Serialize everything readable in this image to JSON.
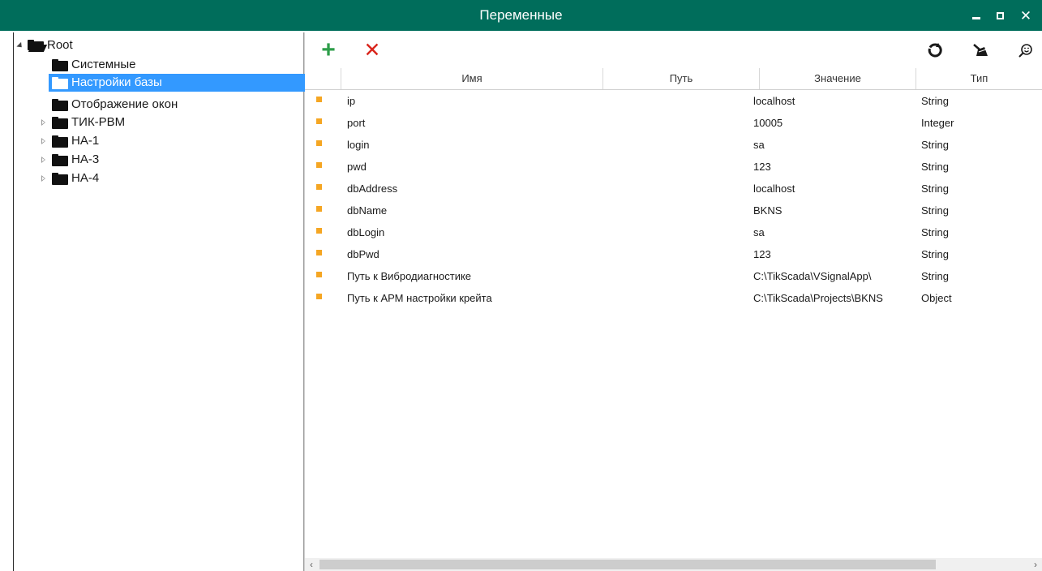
{
  "window": {
    "title": "Переменные",
    "controls": {
      "minimize_icon": "minimize-icon",
      "maximize_icon": "maximize-icon",
      "close_glyph": "✕"
    }
  },
  "tree": {
    "root": {
      "label": "Root"
    },
    "children": [
      {
        "label": "Системные",
        "expandable": false,
        "selected": false
      },
      {
        "label": "Настройки базы",
        "expandable": false,
        "selected": true
      },
      {
        "label": "Отображение окон",
        "expandable": false,
        "selected": false
      },
      {
        "label": "ТИК-РВМ",
        "expandable": true,
        "selected": false
      },
      {
        "label": "НА-1",
        "expandable": true,
        "selected": false
      },
      {
        "label": "НА-3",
        "expandable": true,
        "selected": false
      },
      {
        "label": "НА-4",
        "expandable": true,
        "selected": false
      }
    ]
  },
  "toolbar": {
    "add_glyph": "+",
    "delete_glyph": "✕",
    "refresh_icon": "refresh-icon",
    "clean_icon": "broom-icon",
    "search_icon": "search-icon"
  },
  "grid": {
    "columns": [
      "Имя",
      "Путь",
      "Значение",
      "Тип"
    ],
    "rows": [
      {
        "name": "ip",
        "path": "",
        "value": "localhost",
        "type": "String"
      },
      {
        "name": "port",
        "path": "",
        "value": "10005",
        "type": "Integer"
      },
      {
        "name": "login",
        "path": "",
        "value": "sa",
        "type": "String"
      },
      {
        "name": "pwd",
        "path": "",
        "value": "123",
        "type": "String"
      },
      {
        "name": "dbAddress",
        "path": "",
        "value": "localhost",
        "type": "String"
      },
      {
        "name": "dbName",
        "path": "",
        "value": "BKNS",
        "type": "String"
      },
      {
        "name": "dbLogin",
        "path": "",
        "value": "sa",
        "type": "String"
      },
      {
        "name": "dbPwd",
        "path": "",
        "value": "123",
        "type": "String"
      },
      {
        "name": "Путь к Вибродиагностике",
        "path": "",
        "value": "C:\\TikScada\\VSignalApp\\",
        "type": "String"
      },
      {
        "name": "Путь к АРМ настройки крейта",
        "path": "",
        "value": "C:\\TikScada\\Projects\\BKNS",
        "type": "Object"
      }
    ]
  },
  "scrollbar": {
    "left_glyph": "‹",
    "right_glyph": "›"
  },
  "colors": {
    "titlebar": "#006d5b",
    "selection": "#3399ff",
    "row_marker": "#f5a623",
    "add": "#2e9e4a",
    "delete": "#d9251c"
  }
}
